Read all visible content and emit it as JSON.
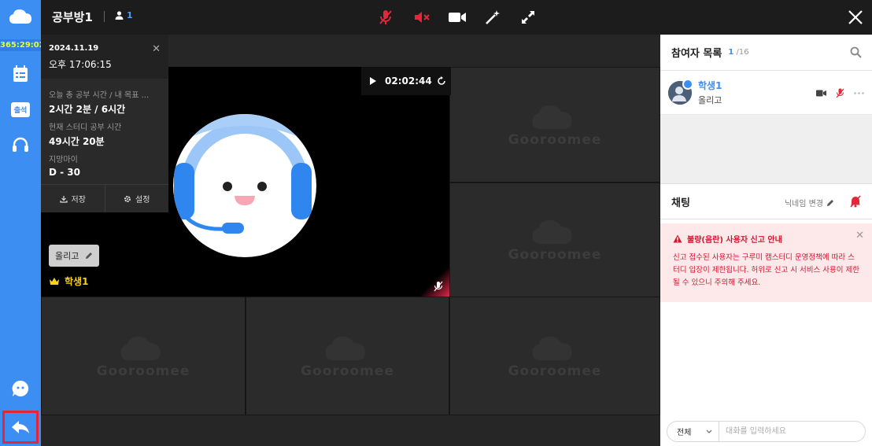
{
  "sidebar": {
    "timer": "365:29:02",
    "attendance_label": "출석"
  },
  "header": {
    "room_title": "공부방1",
    "user_count": "1"
  },
  "info_panel": {
    "date": "2024.11.19",
    "time": "오후 17:06:15",
    "goal_label": "오늘 총 공부 시간 / 내 목표 ...",
    "goal_value": "2시간 2분 / 6시간",
    "current_label": "현재 스터디 공부 시간",
    "current_value": "49시간 20분",
    "dday_label": "지망마이",
    "dday_value": "D - 30",
    "save_label": "저장",
    "settings_label": "설정"
  },
  "main_video": {
    "timer": "02:02:44",
    "status_chip": "올리고",
    "user_name": "학생1"
  },
  "tiles": {
    "logo_text": "Gooroomee"
  },
  "participants": {
    "title": "참여자 목록",
    "current": "1",
    "max": "/16",
    "list": [
      {
        "name": "학생1",
        "status": "올리고"
      }
    ]
  },
  "chat": {
    "title": "채팅",
    "nick_change": "닉네임 변경",
    "notice_title": "불량(음란) 사용자 신고 안내",
    "notice_text": "신고 접수된 사용자는 구루미 캠스터디 운영정책에 따라 스터디 입장이 제한됩니다. 허위로 신고 시 서비스 사용이 제한될 수 있으니 주의해 주세요.",
    "target_select": "전체",
    "input_placeholder": "대화를 입력하세요"
  },
  "colors": {
    "sidebar": "#3d8ef2",
    "accent": "#3d8ef2",
    "danger": "#e0283a",
    "timer": "#e8ff2e"
  }
}
